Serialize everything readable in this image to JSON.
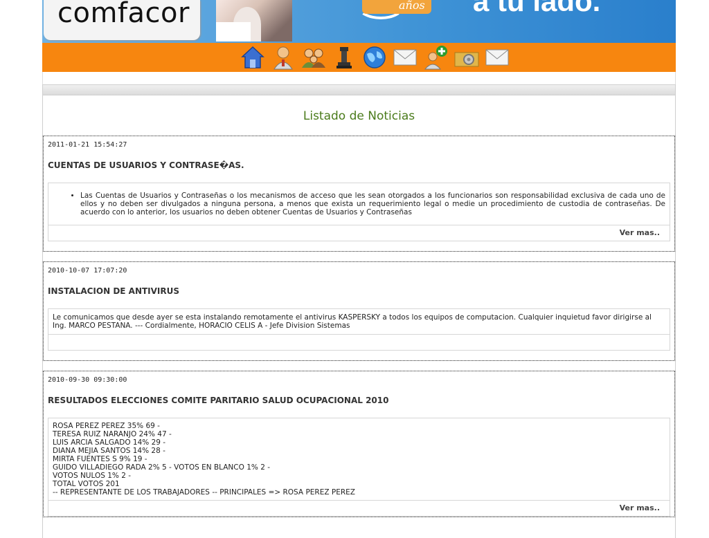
{
  "banner": {
    "logo_text": "comfacor",
    "anos_text": "años",
    "slogan_fragment": "a tu lado."
  },
  "toolbar": {
    "icons": [
      "home-icon",
      "user-icon",
      "group-icon",
      "chess-icon",
      "globe-icon",
      "mail-icon",
      "add-user-icon",
      "settings-icon",
      "mail-icon"
    ]
  },
  "page": {
    "title": "Listado de Noticias"
  },
  "news": [
    {
      "date": "2011-01-21 15:54:27",
      "title": "CUENTAS DE USUARIOS Y CONTRASE�AS.",
      "body": "Las Cuentas de Usuarios y Contraseñas o los mecanismos de acceso que les sean otorgados a los funcionarios son responsabilidad exclusiva de cada uno de ellos y no deben ser divulgados a ninguna persona, a menos que exista un requerimiento legal o medie un procedimiento de custodia de contraseñas. De acuerdo con lo anterior, los usuarios no deben obtener Cuentas de Usuarios y Contraseñas",
      "more": "Ver mas.."
    },
    {
      "date": "2010-10-07 17:07:20",
      "title": "INSTALACION DE ANTIVIRUS",
      "body": "Le comunicamos que desde ayer se esta instalando remotamente el antivirus KASPERSKY a todos los equipos de computacion. Cualquier inquietud favor dirigirse al Ing. MARCO PESTANA. --- Cordialmente, HORACIO CELIS A - Jefe Division Sistemas"
    },
    {
      "date": "2010-09-30 09:30:00",
      "title": "RESULTADOS ELECCIONES COMITE PARITARIO SALUD OCUPACIONAL 2010",
      "lines": [
        "ROSA PEREZ PEREZ 35% 69 -",
        "TERESA RUIZ NARANJO 24% 47 -",
        "LUIS ARCIA SALGADO 14% 29 -",
        "DIANA MEJIA SANTOS 14% 28 -",
        "MIRTA FUENTES S 9% 19 -",
        "GUIDO VILLADIEGO RADA 2% 5 - VOTOS EN BLANCO 1% 2 -",
        "VOTOS NULOS 1% 2 -",
        "TOTAL VOTOS 201",
        "-- REPRESENTANTE DE LOS TRABAJADORES -- PRINCIPALES => ROSA PEREZ PEREZ"
      ],
      "more": "Ver mas.."
    }
  ]
}
